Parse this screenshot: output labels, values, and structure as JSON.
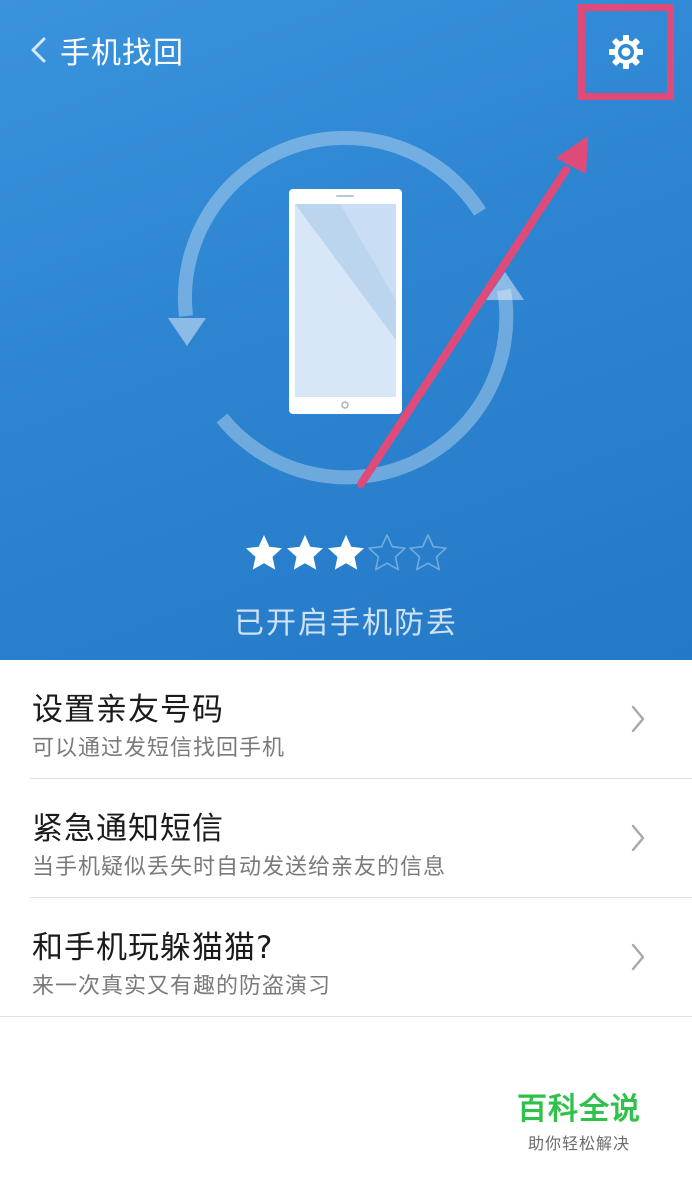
{
  "header": {
    "title": "手机找回",
    "back_icon": "chevron-left-icon",
    "settings_icon": "gear-icon"
  },
  "protection": {
    "rating": 3,
    "max_rating": 5,
    "status": "已开启手机防丢"
  },
  "list": {
    "items": [
      {
        "title": "设置亲友号码",
        "subtitle": "可以通过发短信找回手机"
      },
      {
        "title": "紧急通知短信",
        "subtitle": "当手机疑似丢失时自动发送给亲友的信息"
      },
      {
        "title": "和手机玩躲猫猫?",
        "subtitle": "来一次真实又有趣的防盗演习"
      }
    ]
  },
  "watermark": {
    "title": "百科全说",
    "subtitle": "助你轻松解决"
  },
  "colors": {
    "header_bg": "#2d85d2",
    "annotation": "#e04a78",
    "star_on": "#ffffff",
    "watermark_green": "#2fc24a"
  }
}
